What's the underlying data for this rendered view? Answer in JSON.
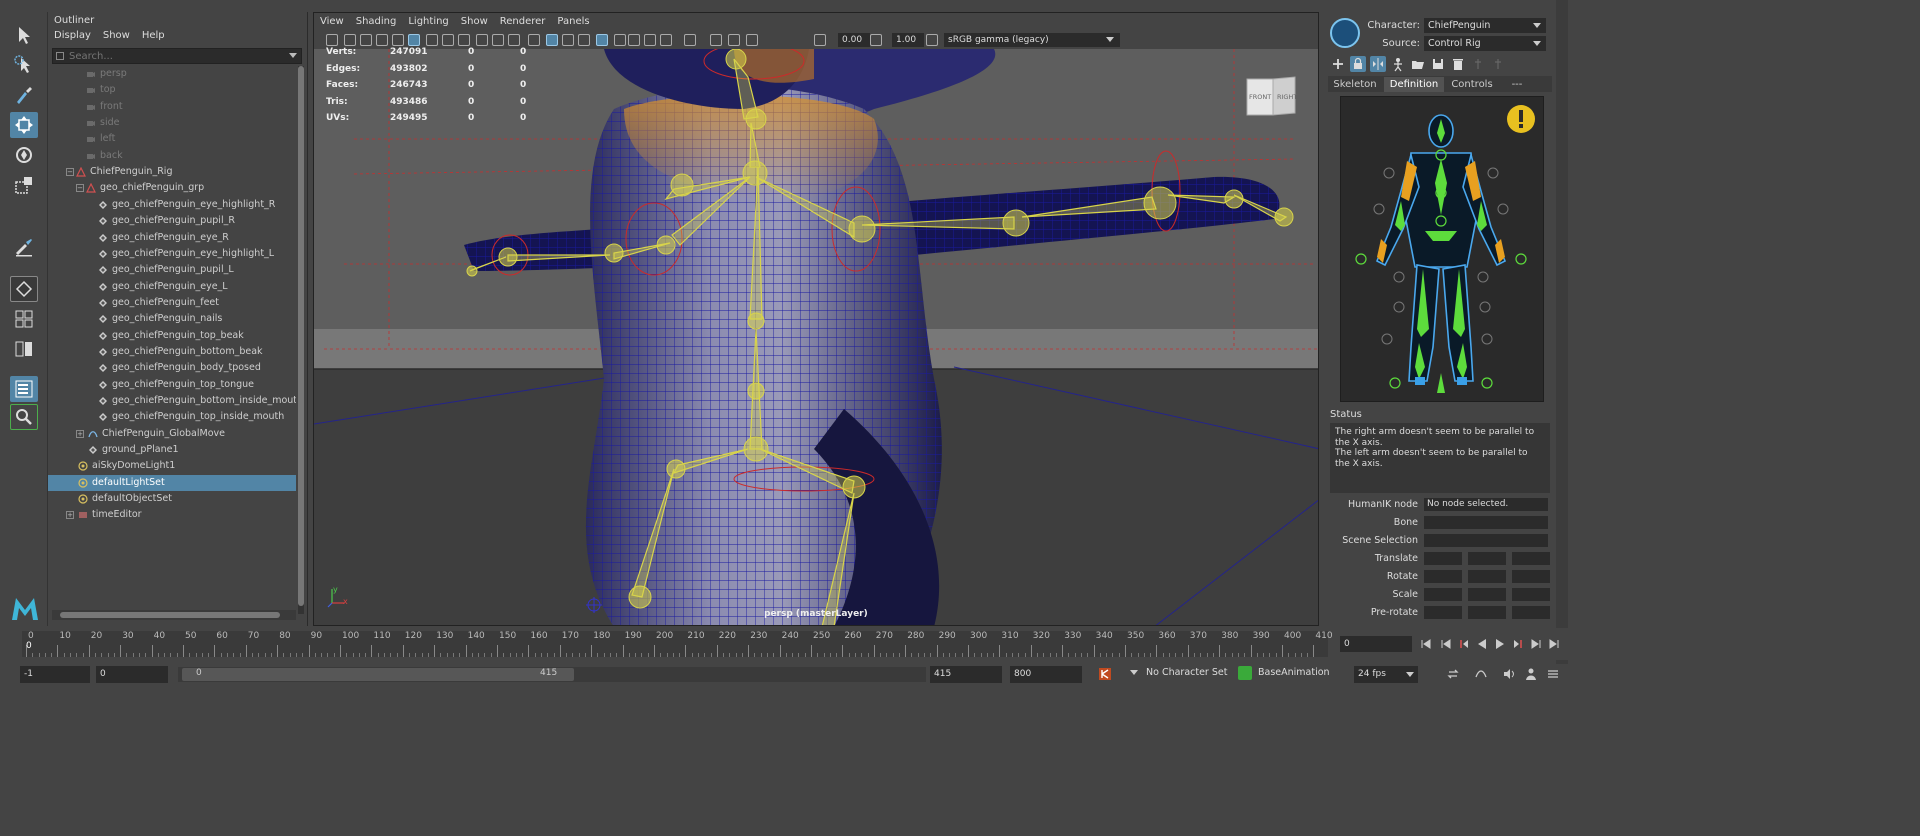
{
  "outliner": {
    "title": "Outliner",
    "menu": [
      "Display",
      "Show",
      "Help"
    ],
    "search_placeholder": "Search...",
    "items": [
      {
        "label": "persp",
        "dim": true
      },
      {
        "label": "top",
        "dim": true
      },
      {
        "label": "front",
        "dim": true
      },
      {
        "label": "side",
        "dim": true
      },
      {
        "label": "left",
        "dim": true
      },
      {
        "label": "back",
        "dim": true
      },
      {
        "label": "ChiefPenguin_Rig"
      },
      {
        "label": "geo_chiefPenguin_grp"
      },
      {
        "label": "geo_chiefPenguin_eye_highlight_R"
      },
      {
        "label": "geo_chiefPenguin_pupil_R"
      },
      {
        "label": "geo_chiefPenguin_eye_R"
      },
      {
        "label": "geo_chiefPenguin_eye_highlight_L"
      },
      {
        "label": "geo_chiefPenguin_pupil_L"
      },
      {
        "label": "geo_chiefPenguin_eye_L"
      },
      {
        "label": "geo_chiefPenguin_feet"
      },
      {
        "label": "geo_chiefPenguin_nails"
      },
      {
        "label": "geo_chiefPenguin_top_beak"
      },
      {
        "label": "geo_chiefPenguin_bottom_beak"
      },
      {
        "label": "geo_chiefPenguin_body_tposed"
      },
      {
        "label": "geo_chiefPenguin_top_tongue"
      },
      {
        "label": "geo_chiefPenguin_bottom_inside_mouth"
      },
      {
        "label": "geo_chiefPenguin_top_inside_mouth"
      },
      {
        "label": "ChiefPenguin_GlobalMove"
      },
      {
        "label": "ground_pPlane1"
      },
      {
        "label": "aiSkyDomeLight1"
      },
      {
        "label": "defaultLightSet",
        "selected": true
      },
      {
        "label": "defaultObjectSet"
      },
      {
        "label": "timeEditor"
      }
    ]
  },
  "viewport": {
    "menu": [
      "View",
      "Shading",
      "Lighting",
      "Show",
      "Renderer",
      "Panels"
    ],
    "exposure": "0.00",
    "gamma": "1.00",
    "color_space": "sRGB gamma (legacy)",
    "hud": [
      {
        "label": "Verts:",
        "v1": "247091",
        "v2": "0",
        "v3": "0"
      },
      {
        "label": "Edges:",
        "v1": "493802",
        "v2": "0",
        "v3": "0"
      },
      {
        "label": "Faces:",
        "v1": "246743",
        "v2": "0",
        "v3": "0"
      },
      {
        "label": "Tris:",
        "v1": "493486",
        "v2": "0",
        "v3": "0"
      },
      {
        "label": "UVs:",
        "v1": "249495",
        "v2": "0",
        "v3": "0"
      }
    ],
    "viewcube_front": "FRONT",
    "viewcube_right": "RIGHT",
    "camera_label": "persp (masterLayer)",
    "axis_y": "y",
    "axis_x": "x"
  },
  "humanik": {
    "character_label": "Character:",
    "character_value": "ChiefPenguin",
    "source_label": "Source:",
    "source_value": "Control Rig",
    "tabs": [
      "Skeleton",
      "Definition",
      "Controls",
      "---"
    ],
    "active_tab": "Definition",
    "status_title": "Status",
    "status_lines": [
      "The right arm doesn't seem to be parallel to the X axis.",
      "The left arm doesn't seem to be parallel to the X axis."
    ],
    "props": [
      {
        "label": "HumanIK node",
        "value": "No node selected."
      },
      {
        "label": "Bone",
        "value": ""
      },
      {
        "label": "Scene Selection",
        "value": ""
      },
      {
        "label": "Translate",
        "value": ""
      },
      {
        "label": "Rotate",
        "value": ""
      },
      {
        "label": "Scale",
        "value": ""
      },
      {
        "label": "Pre-rotate",
        "value": ""
      }
    ]
  },
  "timeline": {
    "ticks": [
      "0",
      "10",
      "20",
      "30",
      "40",
      "50",
      "60",
      "70",
      "80",
      "90",
      "100",
      "110",
      "120",
      "130",
      "140",
      "150",
      "160",
      "170",
      "180",
      "190",
      "200",
      "210",
      "220",
      "230",
      "240",
      "250",
      "260",
      "270",
      "280",
      "290",
      "300",
      "310",
      "320",
      "330",
      "340",
      "350",
      "360",
      "370",
      "380",
      "390",
      "400",
      "410"
    ],
    "current_frame_marker": "0",
    "current_frame": "0"
  },
  "range": {
    "anim_start": "-1",
    "start": "0",
    "slider_start": "0",
    "slider_end": "415",
    "end": "415",
    "anim_end": "800",
    "character_set": "No Character Set",
    "anim_layer": "BaseAnimation",
    "fps": "24 fps"
  },
  "colors": {
    "selection": "#5285a6",
    "joint_yellow": "#d8d44a",
    "wire_blue": "#1a1aa0",
    "hik_green": "#5ddc3c"
  }
}
